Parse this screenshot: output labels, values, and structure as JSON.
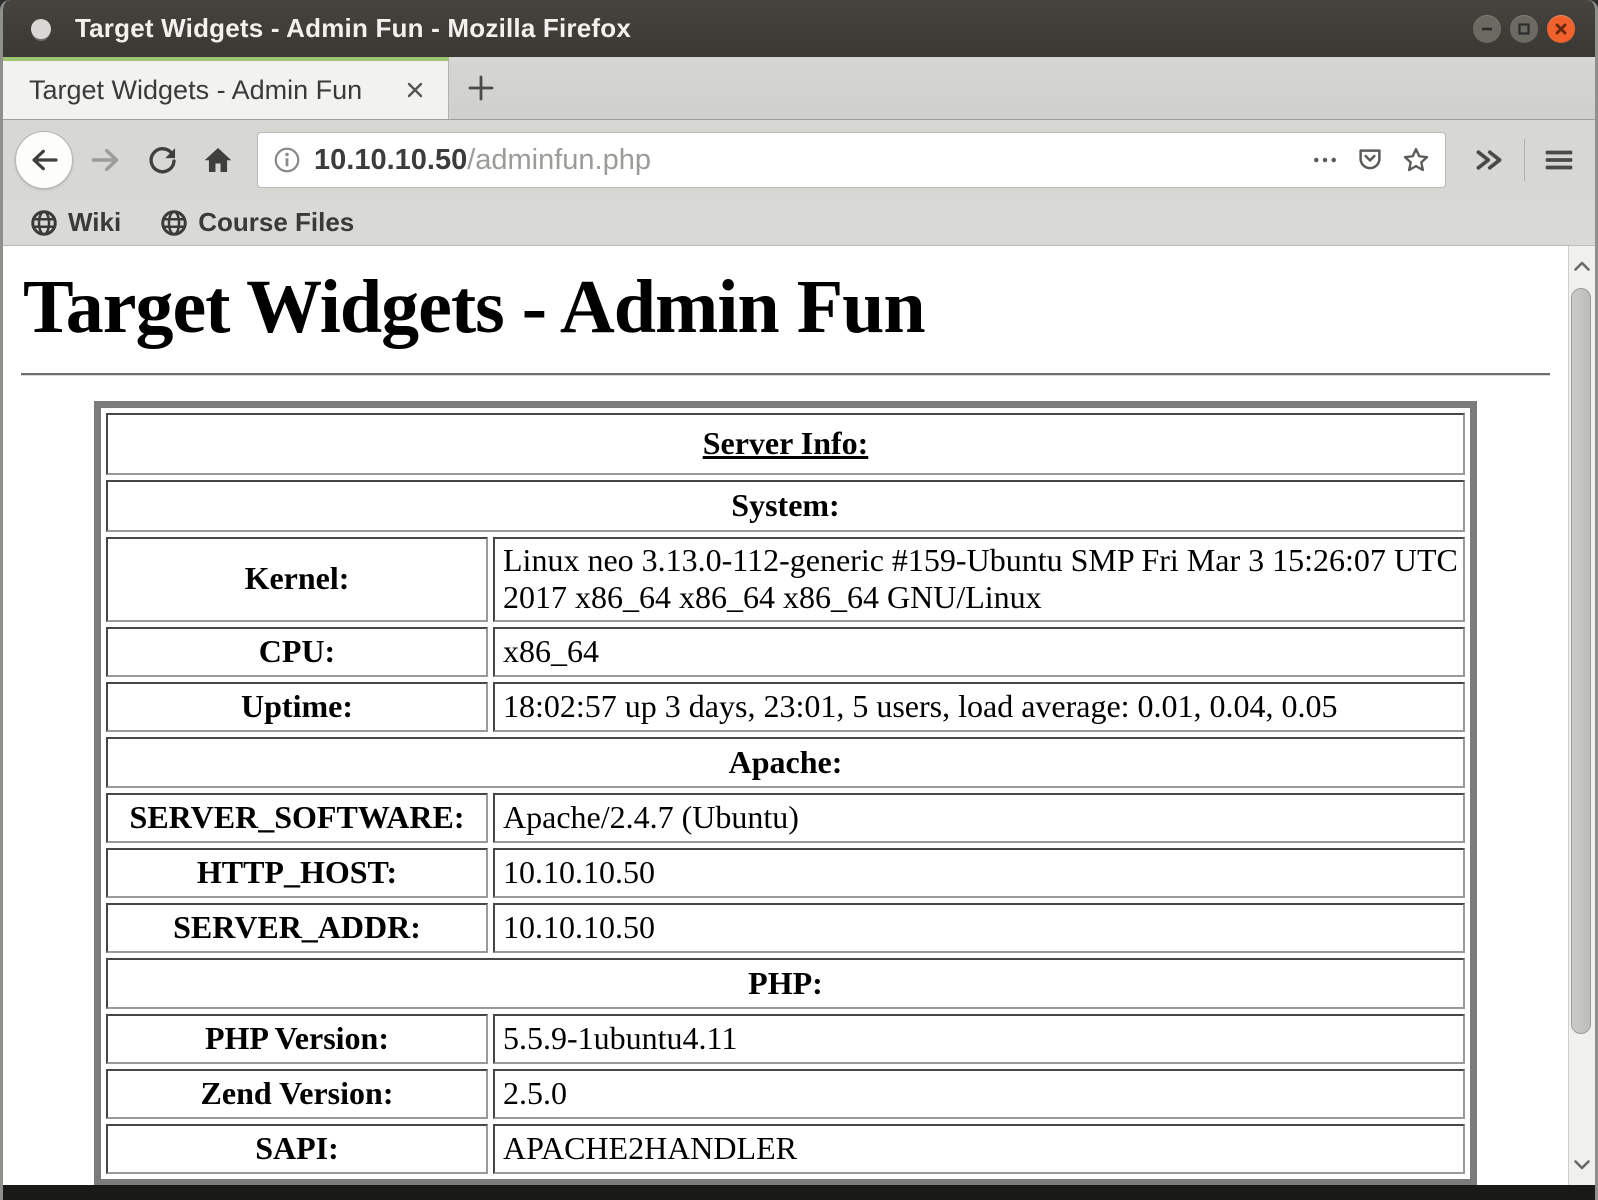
{
  "window": {
    "title": "Target Widgets - Admin Fun - Mozilla Firefox",
    "controls": {
      "minimize": "minimize",
      "maximize": "maximize",
      "close": "close"
    }
  },
  "tab_bar": {
    "active_tab_label": "Target Widgets - Admin Fun"
  },
  "toolbar": {
    "url_host": "10.10.10.50",
    "url_path": "/adminfun.php",
    "icons": [
      "back-arrow",
      "forward-arrow",
      "reload",
      "home",
      "site-info",
      "page-actions-ellipsis",
      "pocket",
      "bookmark-star",
      "overflow-chevrons",
      "hamburger-menu"
    ]
  },
  "bookmarks_bar": {
    "items": [
      {
        "icon": "globe-icon",
        "label": "Wiki"
      },
      {
        "icon": "globe-icon",
        "label": "Course Files"
      }
    ]
  },
  "page": {
    "heading": "Target Widgets - Admin Fun",
    "server_info_table": {
      "title": "Server Info:",
      "sections": [
        {
          "header": "System:",
          "rows": [
            {
              "label": "Kernel:",
              "value": "Linux neo 3.13.0-112-generic #159-Ubuntu SMP Fri Mar 3 15:26:07 UTC 2017 x86_64 x86_64 x86_64 GNU/Linux"
            },
            {
              "label": "CPU:",
              "value": "x86_64"
            },
            {
              "label": "Uptime:",
              "value": "18:02:57 up 3 days, 23:01, 5 users, load average: 0.01, 0.04, 0.05"
            }
          ]
        },
        {
          "header": "Apache:",
          "rows": [
            {
              "label": "SERVER_SOFTWARE:",
              "value": "Apache/2.4.7 (Ubuntu)"
            },
            {
              "label": "HTTP_HOST:",
              "value": "10.10.10.50"
            },
            {
              "label": "SERVER_ADDR:",
              "value": "10.10.10.50"
            }
          ]
        },
        {
          "header": "PHP:",
          "rows": [
            {
              "label": "PHP Version:",
              "value": "5.5.9-1ubuntu4.11"
            },
            {
              "label": "Zend Version:",
              "value": "2.5.0"
            },
            {
              "label": "SAPI:",
              "value": "APACHE2HANDLER"
            }
          ]
        }
      ]
    }
  },
  "colors": {
    "titlebar_bg": "#3a3935",
    "close_button": "#f0612c",
    "active_tab_accent": "#9fc46f",
    "toolbar_bg": "#d7d7d4",
    "table_border": "#7b7b7b",
    "url_host_color": "#3c3c3c",
    "url_path_color": "#9b9b98"
  }
}
